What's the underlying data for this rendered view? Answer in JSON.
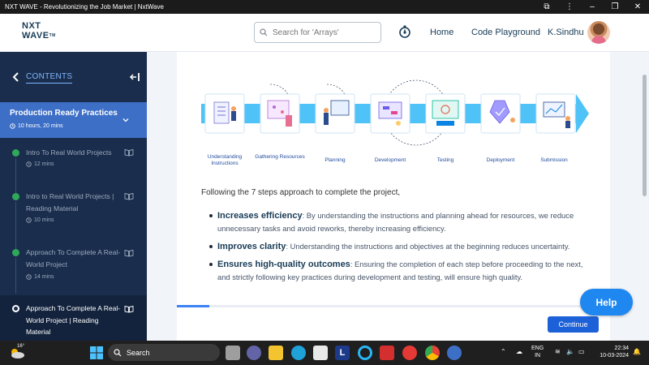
{
  "browser": {
    "title": "NXT WAVE - Revolutionizing the Job Market | NxtWave"
  },
  "header": {
    "logo_line1": "NXT",
    "logo_line2": "WAVE",
    "logo_tm": "TM",
    "search_placeholder": "Search for 'Arrays'",
    "nav_home": "Home",
    "nav_playground": "Code Playground",
    "user_name": "K.Sindhu"
  },
  "sidebar": {
    "contents_label": "CONTENTS",
    "section": {
      "title": "Production Ready Practices",
      "duration": "10 hours, 20 mins"
    },
    "items": [
      {
        "label": "Intro To Real World Projects",
        "duration": "12 mins",
        "status": "done"
      },
      {
        "label": "Intro to Real World Projects | Reading Material",
        "duration": "10 mins",
        "status": "done"
      },
      {
        "label": "Approach To Complete A Real-World Project",
        "duration": "14 mins",
        "status": "done"
      },
      {
        "label": "Approach To Complete A Real-World Project | Reading Material",
        "duration": "",
        "status": "current"
      }
    ]
  },
  "main": {
    "steps": [
      {
        "label": "Understanding Instructions"
      },
      {
        "label": "Gathering Resources"
      },
      {
        "label": "Planning"
      },
      {
        "label": "Development"
      },
      {
        "label": "Testing"
      },
      {
        "label": "Deployment"
      },
      {
        "label": "Submission"
      }
    ],
    "intro": "Following the 7 steps approach to complete the project,",
    "bullets": [
      {
        "title": "Increases efficiency",
        "text": ": By understanding the instructions and planning ahead for resources, we reduce unnecessary tasks and avoid reworks, thereby increasing efficiency."
      },
      {
        "title": "Improves clarity",
        "text": ": Understanding the instructions and objectives at the beginning reduces uncertainty."
      },
      {
        "title": "Ensures high-quality outcomes",
        "text": ": Ensuring the completion of each step before proceeding to the next, and strictly following key practices during development and testing, will ensure high quality."
      }
    ],
    "continue_label": "Continue",
    "help_label": "Help",
    "progress_fraction": 0.075
  },
  "taskbar": {
    "temperature": "16°",
    "search_label": "Search",
    "lang_line1": "ENG",
    "lang_line2": "IN",
    "time": "22:34",
    "date": "10-03-2024"
  },
  "colors": {
    "sidebar_bg": "#1a2d4c",
    "section_active": "#3d6fc7",
    "accent_blue": "#1d61d9",
    "done_green": "#2fa85a",
    "step_arrow": "#4fc3f7"
  }
}
